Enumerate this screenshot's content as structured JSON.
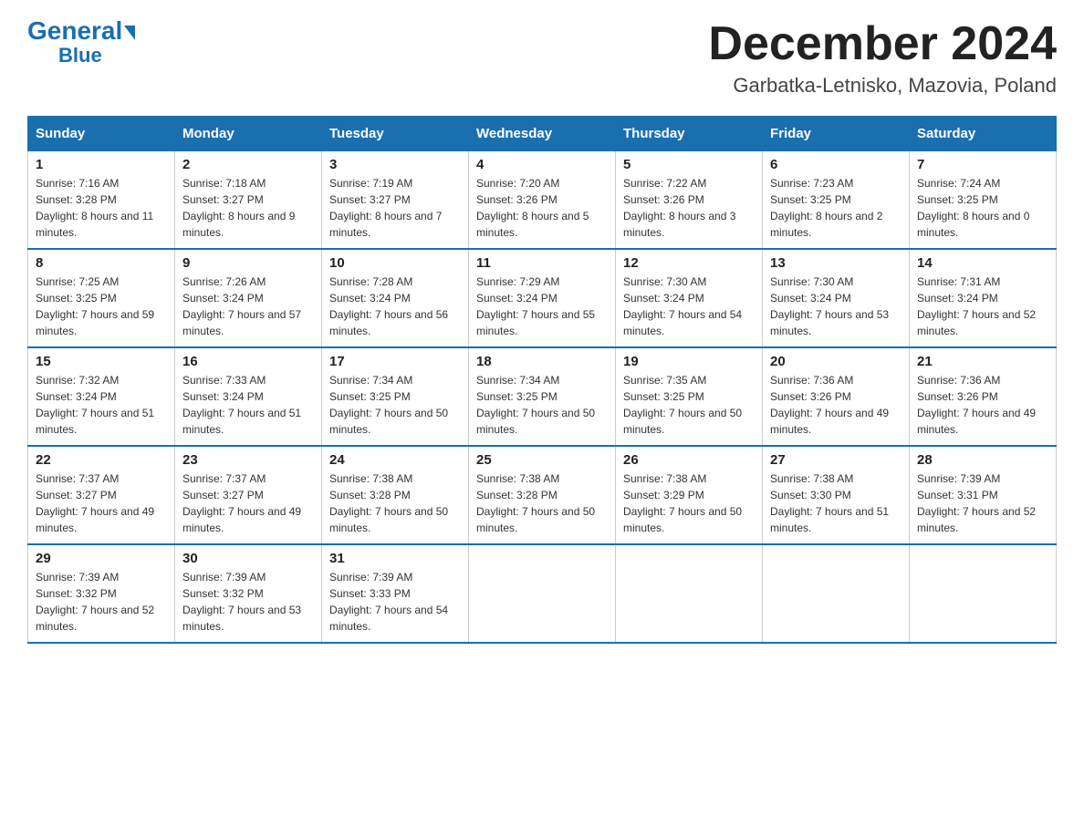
{
  "header": {
    "logo_general": "General",
    "logo_blue": "Blue",
    "month_title": "December 2024",
    "location": "Garbatka-Letnisko, Mazovia, Poland"
  },
  "days_of_week": [
    "Sunday",
    "Monday",
    "Tuesday",
    "Wednesday",
    "Thursday",
    "Friday",
    "Saturday"
  ],
  "weeks": [
    [
      {
        "day": "1",
        "sunrise": "7:16 AM",
        "sunset": "3:28 PM",
        "daylight": "8 hours and 11 minutes."
      },
      {
        "day": "2",
        "sunrise": "7:18 AM",
        "sunset": "3:27 PM",
        "daylight": "8 hours and 9 minutes."
      },
      {
        "day": "3",
        "sunrise": "7:19 AM",
        "sunset": "3:27 PM",
        "daylight": "8 hours and 7 minutes."
      },
      {
        "day": "4",
        "sunrise": "7:20 AM",
        "sunset": "3:26 PM",
        "daylight": "8 hours and 5 minutes."
      },
      {
        "day": "5",
        "sunrise": "7:22 AM",
        "sunset": "3:26 PM",
        "daylight": "8 hours and 3 minutes."
      },
      {
        "day": "6",
        "sunrise": "7:23 AM",
        "sunset": "3:25 PM",
        "daylight": "8 hours and 2 minutes."
      },
      {
        "day": "7",
        "sunrise": "7:24 AM",
        "sunset": "3:25 PM",
        "daylight": "8 hours and 0 minutes."
      }
    ],
    [
      {
        "day": "8",
        "sunrise": "7:25 AM",
        "sunset": "3:25 PM",
        "daylight": "7 hours and 59 minutes."
      },
      {
        "day": "9",
        "sunrise": "7:26 AM",
        "sunset": "3:24 PM",
        "daylight": "7 hours and 57 minutes."
      },
      {
        "day": "10",
        "sunrise": "7:28 AM",
        "sunset": "3:24 PM",
        "daylight": "7 hours and 56 minutes."
      },
      {
        "day": "11",
        "sunrise": "7:29 AM",
        "sunset": "3:24 PM",
        "daylight": "7 hours and 55 minutes."
      },
      {
        "day": "12",
        "sunrise": "7:30 AM",
        "sunset": "3:24 PM",
        "daylight": "7 hours and 54 minutes."
      },
      {
        "day": "13",
        "sunrise": "7:30 AM",
        "sunset": "3:24 PM",
        "daylight": "7 hours and 53 minutes."
      },
      {
        "day": "14",
        "sunrise": "7:31 AM",
        "sunset": "3:24 PM",
        "daylight": "7 hours and 52 minutes."
      }
    ],
    [
      {
        "day": "15",
        "sunrise": "7:32 AM",
        "sunset": "3:24 PM",
        "daylight": "7 hours and 51 minutes."
      },
      {
        "day": "16",
        "sunrise": "7:33 AM",
        "sunset": "3:24 PM",
        "daylight": "7 hours and 51 minutes."
      },
      {
        "day": "17",
        "sunrise": "7:34 AM",
        "sunset": "3:25 PM",
        "daylight": "7 hours and 50 minutes."
      },
      {
        "day": "18",
        "sunrise": "7:34 AM",
        "sunset": "3:25 PM",
        "daylight": "7 hours and 50 minutes."
      },
      {
        "day": "19",
        "sunrise": "7:35 AM",
        "sunset": "3:25 PM",
        "daylight": "7 hours and 50 minutes."
      },
      {
        "day": "20",
        "sunrise": "7:36 AM",
        "sunset": "3:26 PM",
        "daylight": "7 hours and 49 minutes."
      },
      {
        "day": "21",
        "sunrise": "7:36 AM",
        "sunset": "3:26 PM",
        "daylight": "7 hours and 49 minutes."
      }
    ],
    [
      {
        "day": "22",
        "sunrise": "7:37 AM",
        "sunset": "3:27 PM",
        "daylight": "7 hours and 49 minutes."
      },
      {
        "day": "23",
        "sunrise": "7:37 AM",
        "sunset": "3:27 PM",
        "daylight": "7 hours and 49 minutes."
      },
      {
        "day": "24",
        "sunrise": "7:38 AM",
        "sunset": "3:28 PM",
        "daylight": "7 hours and 50 minutes."
      },
      {
        "day": "25",
        "sunrise": "7:38 AM",
        "sunset": "3:28 PM",
        "daylight": "7 hours and 50 minutes."
      },
      {
        "day": "26",
        "sunrise": "7:38 AM",
        "sunset": "3:29 PM",
        "daylight": "7 hours and 50 minutes."
      },
      {
        "day": "27",
        "sunrise": "7:38 AM",
        "sunset": "3:30 PM",
        "daylight": "7 hours and 51 minutes."
      },
      {
        "day": "28",
        "sunrise": "7:39 AM",
        "sunset": "3:31 PM",
        "daylight": "7 hours and 52 minutes."
      }
    ],
    [
      {
        "day": "29",
        "sunrise": "7:39 AM",
        "sunset": "3:32 PM",
        "daylight": "7 hours and 52 minutes."
      },
      {
        "day": "30",
        "sunrise": "7:39 AM",
        "sunset": "3:32 PM",
        "daylight": "7 hours and 53 minutes."
      },
      {
        "day": "31",
        "sunrise": "7:39 AM",
        "sunset": "3:33 PM",
        "daylight": "7 hours and 54 minutes."
      },
      null,
      null,
      null,
      null
    ]
  ],
  "labels": {
    "sunrise": "Sunrise:",
    "sunset": "Sunset:",
    "daylight": "Daylight:"
  }
}
